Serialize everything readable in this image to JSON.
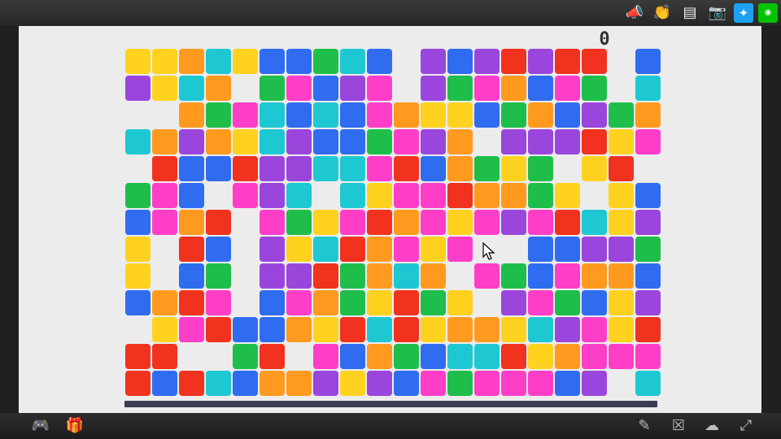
{
  "toolbar": {
    "icons": [
      "megaphone-icon",
      "clap-icon",
      "add-playlist-icon",
      "camera-icon",
      "twitter-icon",
      "line-icon"
    ]
  },
  "bottom_toolbar": {
    "icons": [
      "gamepad-icon",
      "gift-icon",
      "edit-icon",
      "close-comment-icon",
      "upload-icon",
      "fullscreen-icon"
    ]
  },
  "game": {
    "score": "0",
    "palette": {
      "Y": "#ffd21f",
      "O": "#ff9a1f",
      "C": "#1ec8d2",
      "B": "#2f6cf0",
      "G": "#1fbe4b",
      "P": "#9a46dc",
      "K": "#ff3ec8",
      "R": "#f0321e"
    },
    "rows": [
      "YYOCYBBGCB.PBPRPRR.B",
      "PYCO.GKBPK.PGKOBKG.C",
      "..OGKCBCBKOYYBGOBPGO",
      "COPOYCPBBGKPO.PPPRYK",
      ".RBBRPPCCKRBOGYG.YR.",
      "GKB.KPC.CYKKROOGY.YB",
      "BKOR.KGYKROKYKPKRCYP",
      "Y.RB.PYCROKYK..BBPPG",
      "Y.BG.PPRGOCO.KGBKOOB",
      "BORK.BKOGYRGY.PKGBYP",
      ".YKRBBOYRCRYOOYCPKYR",
      "RR..GR.KBOGBCCRYOKKK",
      "RBRCBOOPYPBKGKKKBP.C"
    ]
  }
}
